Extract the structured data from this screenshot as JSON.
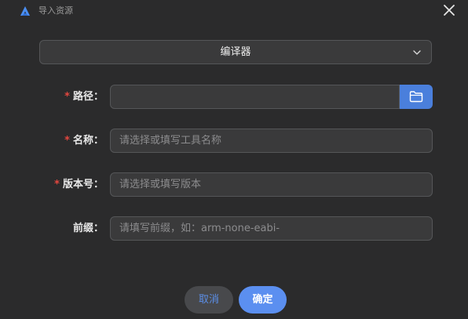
{
  "window": {
    "title": "导入资源",
    "close_icon": "close-icon",
    "logo_icon": "app-logo-icon"
  },
  "type_select": {
    "value": "编译器",
    "icon": "chevron-down-icon"
  },
  "form": {
    "path": {
      "label": "路径：",
      "required_mark": "*",
      "value": "",
      "browse_icon": "folder-icon"
    },
    "name": {
      "label": "名称：",
      "required_mark": "*",
      "placeholder": "请选择或填写工具名称"
    },
    "version": {
      "label": "版本号：",
      "required_mark": "*",
      "placeholder": "请选择或填写版本"
    },
    "prefix": {
      "label": "前缀：",
      "placeholder": "请填写前缀，如：arm-none-eabi-"
    }
  },
  "buttons": {
    "cancel_label": "取消",
    "ok_label": "确定"
  },
  "colors": {
    "background": "#2b2b2c",
    "input_background": "#3a3a3b",
    "accent": "#5b8ff0",
    "required": "#e4473f"
  }
}
